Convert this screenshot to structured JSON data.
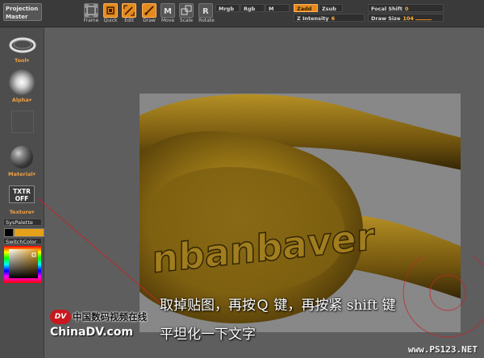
{
  "toolbar": {
    "projection_master": [
      "Projection",
      "Master"
    ],
    "buttons": [
      {
        "label": "Frame",
        "icon": "frame-icon",
        "active": false
      },
      {
        "label": "Quick",
        "icon": "quick-icon",
        "active": true
      },
      {
        "label": "Edit",
        "icon": "edit-icon",
        "active": true
      },
      {
        "label": "Draw",
        "icon": "draw-icon",
        "active": true
      },
      {
        "label": "Move",
        "icon": "move-icon",
        "active": false
      },
      {
        "label": "Scale",
        "icon": "scale-icon",
        "active": false
      },
      {
        "label": "Rotate",
        "icon": "rotate-icon",
        "active": false
      }
    ],
    "mrgb": "Mrgb",
    "rgb": "Rgb",
    "m": "M",
    "zadd": "Zadd",
    "zsub": "Zsub",
    "z_intensity_label": "Z Intensity",
    "z_intensity_value": "6",
    "focal_shift_label": "Focal Shift",
    "focal_shift_value": "0",
    "draw_size_label": "Draw Size",
    "draw_size_value": "104"
  },
  "leftbar": {
    "tool_label": "Tool",
    "alpha_label": "Alpha",
    "material_label": "Material",
    "txtr": [
      "TXTR",
      "OFF"
    ],
    "texture_label": "Texture",
    "syspalette": "SysPalette",
    "switchcolor": "SwitchColor",
    "main_color": "#e5a11a"
  },
  "canvas": {
    "embossed_text": "nbanbaver",
    "annotation_line1": "取掉贴图，再按Ｑ 键，再按紧 shift 键",
    "annotation_line2": "平坦化一下文字"
  },
  "branding": {
    "logo_badge": "DV",
    "logo_cn": "中国数码视频在线",
    "logo_en": "ChinaDV.com",
    "watermark": "www.PS123.NET"
  }
}
